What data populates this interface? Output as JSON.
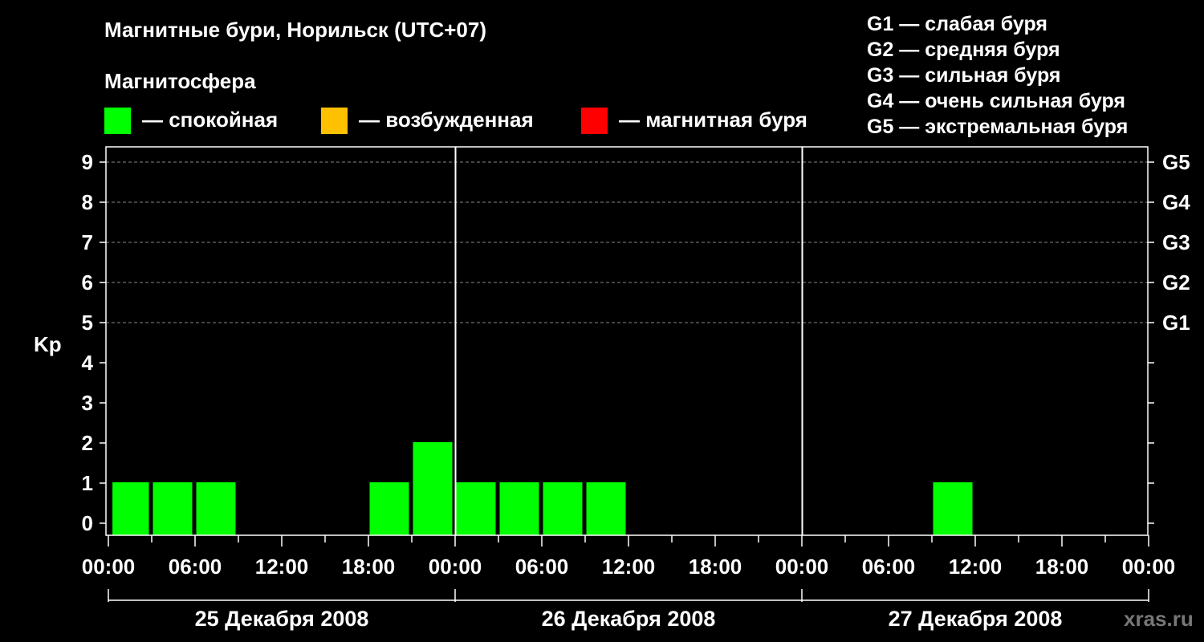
{
  "header": {
    "title": "Магнитные бури, Норильск (UTC+07)",
    "subtitle": "Магнитосфера"
  },
  "legend": [
    {
      "label": "— спокойная",
      "color": "#00ff00"
    },
    {
      "label": "— возбужденная",
      "color": "#ffc000"
    },
    {
      "label": "— магнитная буря",
      "color": "#ff0000"
    }
  ],
  "g_legend": [
    "G1 — слабая буря",
    "G2 — средняя буря",
    "G3 — сильная буря",
    "G4 — очень сильная буря",
    "G5 — экстремальная буря"
  ],
  "watermark": "xras.ru",
  "chart_data": {
    "type": "bar",
    "ylabel": "Kp",
    "ylim": [
      0,
      9
    ],
    "y_ticks": [
      "0",
      "1",
      "2",
      "3",
      "4",
      "5",
      "6",
      "7",
      "8",
      "9"
    ],
    "right_ticks": [
      {
        "value": 5,
        "label": "G1"
      },
      {
        "value": 6,
        "label": "G2"
      },
      {
        "value": 7,
        "label": "G3"
      },
      {
        "value": 8,
        "label": "G4"
      },
      {
        "value": 9,
        "label": "G5"
      }
    ],
    "grid": "dashed at Kp 5-9",
    "x_tick_labels": [
      "00:00",
      "06:00",
      "12:00",
      "18:00",
      "00:00",
      "06:00",
      "12:00",
      "18:00",
      "00:00",
      "06:00",
      "12:00",
      "18:00",
      "00:00"
    ],
    "days": [
      "25 Декабря 2008",
      "26 Декабря 2008",
      "27 Декабря 2008"
    ],
    "colors": {
      "quiet": "#00ff00",
      "active": "#ffc000",
      "storm": "#ff0000"
    },
    "bars": [
      {
        "start_hour": 0.2,
        "end_hour": 3,
        "kp": 1
      },
      {
        "start_hour": 3,
        "end_hour": 6,
        "kp": 1
      },
      {
        "start_hour": 6,
        "end_hour": 9,
        "kp": 1
      },
      {
        "start_hour": 18,
        "end_hour": 21,
        "kp": 1
      },
      {
        "start_hour": 21,
        "end_hour": 24,
        "kp": 2
      },
      {
        "start_hour": 24,
        "end_hour": 27,
        "kp": 1
      },
      {
        "start_hour": 27,
        "end_hour": 30,
        "kp": 1
      },
      {
        "start_hour": 30,
        "end_hour": 33,
        "kp": 1
      },
      {
        "start_hour": 33,
        "end_hour": 36,
        "kp": 1
      },
      {
        "start_hour": 57,
        "end_hour": 60,
        "kp": 1
      }
    ]
  }
}
